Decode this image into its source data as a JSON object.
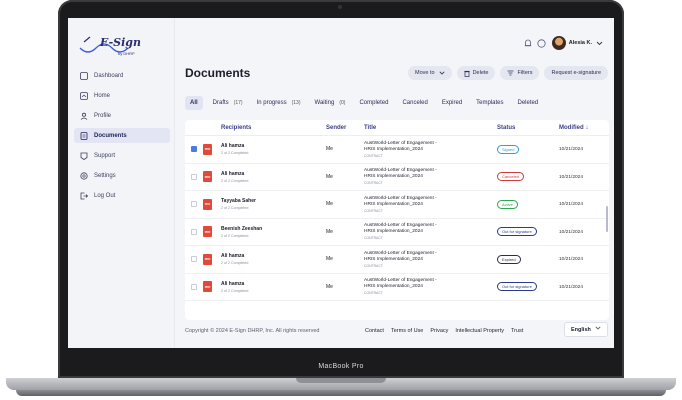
{
  "device_label": "MacBook Pro",
  "brand": {
    "name": "E-Sign",
    "sub": "by DHRP"
  },
  "sidebar": {
    "items": [
      {
        "label": "Dashboard",
        "icon": "dashboard-icon"
      },
      {
        "label": "Home",
        "icon": "home-icon"
      },
      {
        "label": "Profile",
        "icon": "profile-icon"
      },
      {
        "label": "Documents",
        "icon": "documents-icon",
        "active": true
      },
      {
        "label": "Support",
        "icon": "support-icon"
      },
      {
        "label": "Settings",
        "icon": "settings-icon"
      },
      {
        "label": "Log Out",
        "icon": "logout-icon"
      }
    ]
  },
  "header": {
    "user_name": "Alesia K."
  },
  "page": {
    "title": "Documents"
  },
  "actions": {
    "move_to": "Move to",
    "delete": "Delete",
    "filters": "Filters",
    "request": "Request e-signature"
  },
  "tabs": [
    {
      "label": "All",
      "active": true
    },
    {
      "label": "Drafts",
      "count": "(17)"
    },
    {
      "label": "In progress",
      "count": "(13)"
    },
    {
      "label": "Waiting",
      "count": "(0)"
    },
    {
      "label": "Completed"
    },
    {
      "label": "Canceled"
    },
    {
      "label": "Expired"
    },
    {
      "label": "Templates"
    },
    {
      "label": "Deleted"
    }
  ],
  "table": {
    "columns": {
      "recipients": "Recipients",
      "sender": "Sender",
      "title": "Title",
      "status": "Status",
      "modified": "Modified ↓"
    },
    "rows": [
      {
        "checked": true,
        "name": "Ali hamza",
        "sub": "2 of 2 Completed",
        "sender": "Me",
        "title1": "AustWorld-Letter of Engagement -",
        "title2": "HRIS Implementation_2024",
        "type": "CONTRACT",
        "status": "Signed",
        "status_color": "#2f9fd6",
        "modified": "10/21/2024"
      },
      {
        "checked": false,
        "name": "Ali hamza",
        "sub": "2 of 2 Completed",
        "sender": "Me",
        "title1": "AustWorld-Letter of Engagement -",
        "title2": "HRIS Implementation_2024",
        "type": "CONTRACT",
        "status": "Canceled",
        "status_color": "#d23b3b",
        "modified": "10/21/2024"
      },
      {
        "checked": false,
        "name": "Tayyaba Saher",
        "sub": "2 of 2 Completed",
        "sender": "Me",
        "title1": "AustWorld-Letter of Engagement -",
        "title2": "HRIS Implementation_2024",
        "type": "CONTRACT",
        "status": "Active",
        "status_color": "#2ea84d",
        "modified": "10/21/2024"
      },
      {
        "checked": false,
        "name": "Beenish Zeeshan",
        "sub": "2 of 2 Completed",
        "sender": "Me",
        "title1": "AustWorld-Letter of Engagement -",
        "title2": "HRIS Implementation_2024",
        "type": "CONTRACT",
        "status": "Out for signature",
        "status_color": "#2c3a8a",
        "modified": "10/21/2024"
      },
      {
        "checked": false,
        "name": "Ali hamza",
        "sub": "2 of 2 Completed",
        "sender": "Me",
        "title1": "AustWorld-Letter of Engagement -",
        "title2": "HRIS Implementation_2024",
        "type": "CONTRACT",
        "status": "Expired",
        "status_color": "#2a2e45",
        "modified": "10/21/2024"
      },
      {
        "checked": false,
        "name": "Ali hamza",
        "sub": "2 of 2 Completed",
        "sender": "Me",
        "title1": "AustWorld-Letter of Engagement -",
        "title2": "HRIS Implementation_2024",
        "type": "CONTRACT",
        "status": "Out for signature",
        "status_color": "#2c3a8a",
        "modified": "10/21/2024"
      }
    ]
  },
  "footer": {
    "copyright": "Copyright © 2024 E-Sign DHRP, Inc. All rights reserved",
    "links": [
      "Contact",
      "Terms of Use",
      "Privacy",
      "Intellectual Property",
      "Trust"
    ],
    "language": "English"
  }
}
